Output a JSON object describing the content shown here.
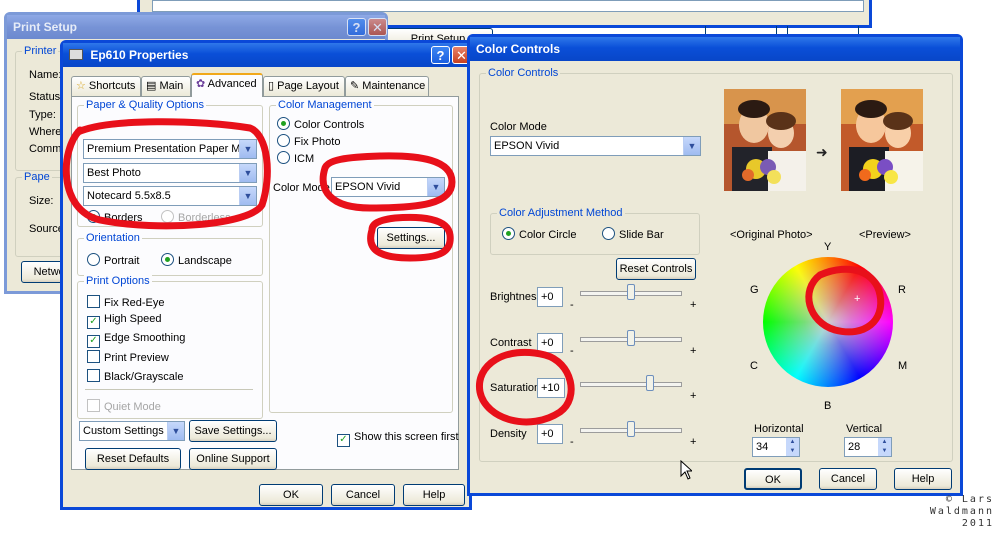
{
  "background_window": {
    "title": "",
    "button": "Print Setup"
  },
  "print_setup": {
    "title": "Print Setup",
    "printer_group": "Printer",
    "labels": [
      "Name:",
      "Status:",
      "Type:",
      "Where:",
      "Comme"
    ],
    "paper_group": "Pape",
    "paper_labels": [
      "Size:",
      "Source:"
    ],
    "network_button": "Networ"
  },
  "ep610": {
    "title": "Ep610 Properties",
    "tabs": [
      "Shortcuts",
      "Main",
      "Advanced",
      "Page Layout",
      "Maintenance"
    ],
    "active_tab": "Advanced",
    "paper_quality": {
      "label": "Paper & Quality Options",
      "media": "Premium Presentation Paper Matte",
      "quality": "Best Photo",
      "size": "Notecard 5.5x8.5",
      "borders": "Borders",
      "borderless": "Borderless"
    },
    "orientation": {
      "label": "Orientation",
      "portrait": "Portrait",
      "landscape": "Landscape",
      "selected": "Landscape"
    },
    "print_options": {
      "label": "Print Options",
      "items": [
        {
          "label": "Fix Red-Eye",
          "checked": false
        },
        {
          "label": "High Speed",
          "checked": true
        },
        {
          "label": "Edge Smoothing",
          "checked": true
        },
        {
          "label": "Print Preview",
          "checked": false
        },
        {
          "label": "Black/Grayscale",
          "checked": false
        }
      ],
      "quiet_mode": "Quiet Mode"
    },
    "color_management": {
      "label": "Color Management",
      "options": [
        "Color Controls",
        "Fix Photo",
        "ICM"
      ],
      "selected": "Color Controls",
      "color_mode_label": "Color Mode",
      "color_mode_value": "EPSON Vivid",
      "settings_button": "Settings..."
    },
    "custom_settings": "Custom Settings",
    "save_settings": "Save Settings...",
    "show_screen": "Show this screen first",
    "reset_defaults": "Reset Defaults",
    "online_support": "Online Support",
    "ok": "OK",
    "cancel": "Cancel",
    "help": "Help"
  },
  "color_controls": {
    "title": "Color Controls",
    "group_label": "Color Controls",
    "color_mode_label": "Color Mode",
    "color_mode_value": "EPSON Vivid",
    "original_caption": "<Original Photo>",
    "preview_caption": "<Preview>",
    "method": {
      "label": "Color Adjustment Method",
      "circle": "Color Circle",
      "slide": "Slide Bar",
      "selected": "Color Circle"
    },
    "reset_controls": "Reset Controls",
    "sliders": [
      {
        "label": "Brightness",
        "value": "+0",
        "level": 0
      },
      {
        "label": "Contrast",
        "value": "+0",
        "level": 0
      },
      {
        "label": "Saturation",
        "value": "+10",
        "level": 10
      },
      {
        "label": "Density",
        "value": "+0",
        "level": 0
      }
    ],
    "slider_minus": "-",
    "slider_plus": "+",
    "wheel_labels": {
      "Y": "Y",
      "R": "R",
      "M": "M",
      "B": "B",
      "C": "C",
      "G": "G"
    },
    "horizontal_label": "Horizontal",
    "horizontal_value": "34",
    "vertical_label": "Vertical",
    "vertical_value": "28",
    "ok": "OK",
    "cancel": "Cancel",
    "help": "Help"
  },
  "copyright": {
    "line1": "© Lars",
    "line2": "Waldmann",
    "line3": "2011"
  },
  "colors": {
    "xp_blue": "#0a48d8",
    "dialog_bg": "#ece9d8",
    "annotation_red": "#e8101a",
    "group_label": "#0046d5"
  }
}
